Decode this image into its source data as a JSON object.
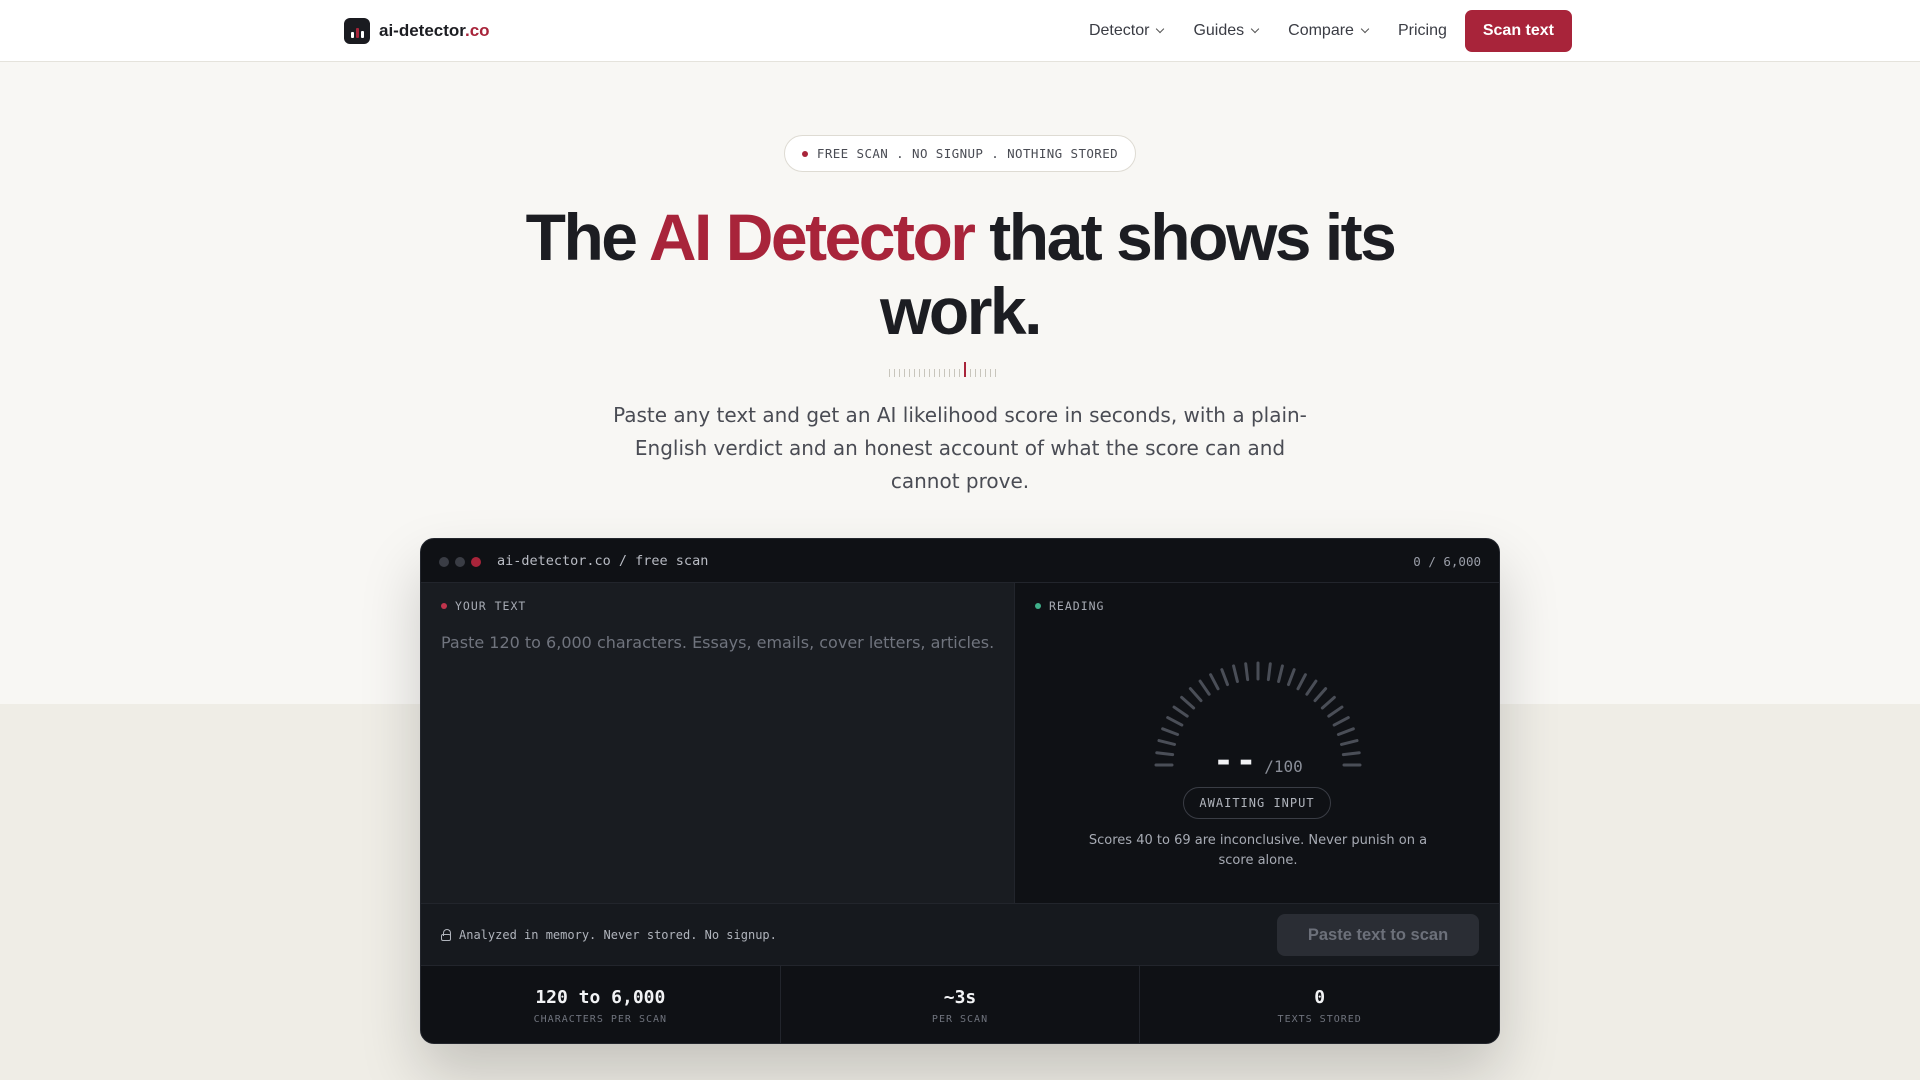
{
  "nav": {
    "brand_main": "ai-detector",
    "brand_tld": ".co",
    "links": [
      {
        "label": "Detector",
        "icon": "chevron-down-icon"
      },
      {
        "label": "Guides",
        "icon": "chevron-down-icon"
      },
      {
        "label": "Compare",
        "icon": "chevron-down-icon"
      },
      {
        "label": "Pricing"
      }
    ],
    "cta_label": "Scan text"
  },
  "hero": {
    "badge": "FREE SCAN . NO SIGNUP . NOTHING STORED",
    "headline_pre": "The ",
    "headline_accent": "AI Detector",
    "headline_post": " that shows its work.",
    "subtitle": "Paste any text and get an AI likelihood score in seconds, with a plain-English verdict and an honest account of what the score can and cannot prove."
  },
  "scanner": {
    "path": "ai-detector.co / free scan",
    "char_count": "0 / 6,000",
    "input_label": "YOUR TEXT",
    "input_placeholder": "Paste 120 to 6,000 characters. Essays, emails, cover letters, articles.",
    "reading_label": "READING",
    "score_value": "--",
    "score_denominator": "/100",
    "status": "AWAITING INPUT",
    "note": "Scores 40 to 69 are inconclusive. Never punish on a score alone.",
    "privacy_note": "Analyzed in memory. Never stored. No signup.",
    "scan_button": "Paste text to scan",
    "stats": [
      {
        "value": "120 to 6,000",
        "label": "CHARACTERS PER SCAN"
      },
      {
        "value": "~3s",
        "label": "PER SCAN"
      },
      {
        "value": "0",
        "label": "TEXTS STORED"
      }
    ]
  },
  "colors": {
    "accent": "#a8243a",
    "reading_dot": "#3fb08a",
    "panel_bg": "#0f1115"
  }
}
